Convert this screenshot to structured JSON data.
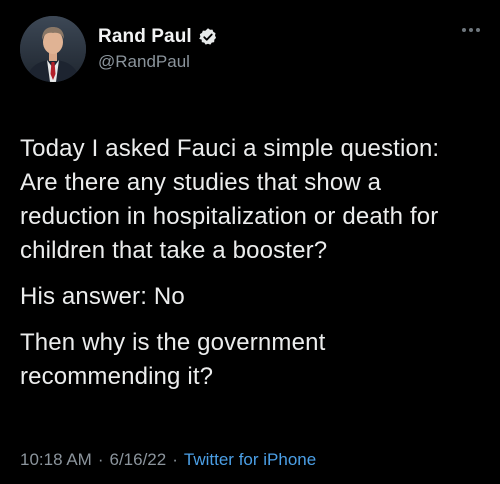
{
  "author": {
    "display_name": "Rand Paul",
    "handle": "@RandPaul",
    "verified": true,
    "avatar_icon": "profile-photo",
    "verified_icon": "verified-badge-icon"
  },
  "tweet": {
    "paragraphs": [
      "Today I asked Fauci a simple question: Are there any studies that show a reduction in hospitalization or death for children that take a booster?",
      "His answer: No",
      "Then why is the government recommending it?"
    ],
    "time": "10:18 AM",
    "date": "6/16/22",
    "source": "Twitter for iPhone",
    "separator": "·"
  },
  "colors": {
    "background": "#000000",
    "text": "#e7e9ea",
    "muted": "#8b949c",
    "link": "#4b9fe6"
  },
  "icons": {
    "more": "more-dots-icon"
  }
}
